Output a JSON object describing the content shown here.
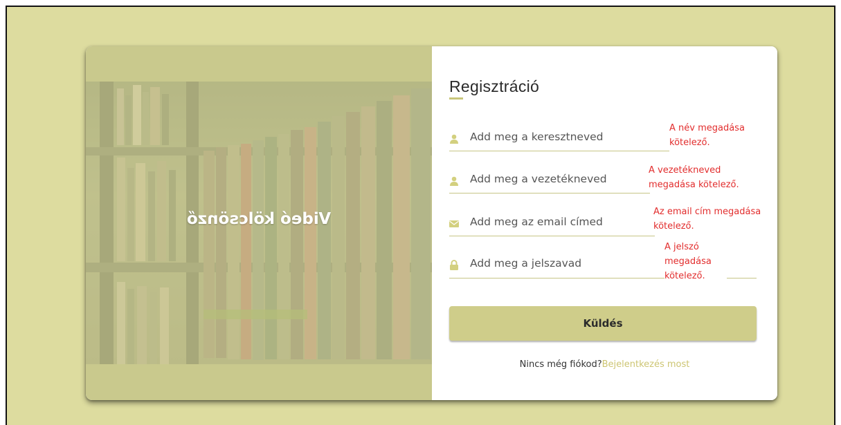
{
  "hero": {
    "text": "Videó kölcsönző"
  },
  "form": {
    "title": "Regisztráció",
    "fields": [
      {
        "icon": "user-icon",
        "placeholder": "Add meg a keresztneved",
        "error": "A név megadása kötelező."
      },
      {
        "icon": "user-icon",
        "placeholder": "Add meg a vezetékneved",
        "error": "A vezetékneved megadása kötelező."
      },
      {
        "icon": "envelope-icon",
        "placeholder": "Add meg az email címed",
        "error": "Az email cím megadása kötelező."
      },
      {
        "icon": "lock-icon",
        "placeholder": "Add meg a jelszavad",
        "error": "A jelszó megadása kötelező."
      }
    ],
    "submit_label": "Küldés",
    "footer_text": "Nincs még fiókod?",
    "footer_link": "Bejelentkezés most"
  },
  "colors": {
    "background": "#dddc9f",
    "accent": "#cfcd8a",
    "icon": "#d3d07f",
    "error": "#e22d2d",
    "link": "#cdc572"
  }
}
